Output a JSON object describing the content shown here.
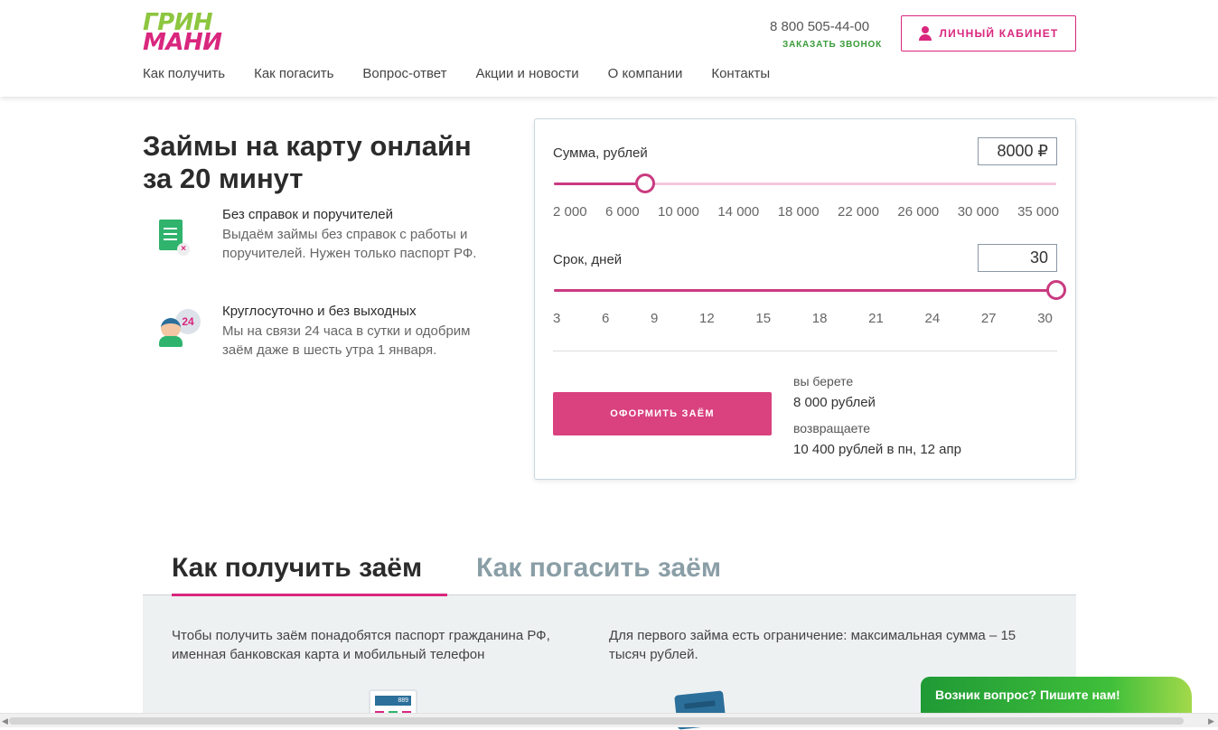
{
  "header": {
    "logo_line1": "ГРИН",
    "logo_line2": "МАНИ",
    "phone": "8 800 505-44-00",
    "callback": "ЗАКАЗАТЬ ЗВОНОК",
    "cabinet_label": "ЛИЧНЫЙ КАБИНЕТ",
    "nav": [
      "Как получить",
      "Как погасить",
      "Вопрос-ответ",
      "Акции и новости",
      "О компании",
      "Контакты"
    ]
  },
  "hero": {
    "title": "Займы на карту онлайн за 20 минут",
    "features": [
      {
        "title": "Без справок и поручителей",
        "text": "Выдаём займы без справок с работы и поручителей. Нужен только паспорт РФ.",
        "icon": "document-icon"
      },
      {
        "title": "Круглосуточно и без выходных",
        "text": "Мы на связи 24 часа в сутки и одобрим заём даже в шесть утра 1 января.",
        "icon": "operator-24-icon"
      }
    ],
    "feature2_badge": "24"
  },
  "calculator": {
    "amount_label": "Сумма, рублей",
    "amount_value": "8000 ₽",
    "amount_fraction": 0.182,
    "amount_ticks": [
      "2 000",
      "6 000",
      "10 000",
      "14 000",
      "18 000",
      "22 000",
      "26 000",
      "30 000",
      "35 000"
    ],
    "term_label": "Срок, дней",
    "term_value": "30",
    "term_fraction": 1.0,
    "term_ticks": [
      "3",
      "6",
      "9",
      "12",
      "15",
      "18",
      "21",
      "24",
      "27",
      "30"
    ],
    "apply_label": "ОФОРМИТЬ ЗАЁМ",
    "take_label": "вы берете",
    "take_value": "8 000 рублей",
    "return_label": "возвращаете",
    "return_value": "10 400 рублей в пн, 12 апр"
  },
  "howto": {
    "tab_active": "Как получить заём",
    "tab_inactive": "Как погасить заём",
    "text_left": "Чтобы получить заём понадобятся паспорт гражданина РФ, именная банковская карта и мобильный телефон",
    "text_right": "Для первого займа есть ограничение: максимальная сумма – 15 тысяч рублей.",
    "calc_display": "889"
  },
  "chat": {
    "label": "Возник вопрос? Пишите нам!"
  },
  "colors": {
    "brand_pink": "#d9277e",
    "brand_green": "#8dc63f",
    "slider": "#c93b80",
    "chat_green": "#3fbf3a"
  }
}
